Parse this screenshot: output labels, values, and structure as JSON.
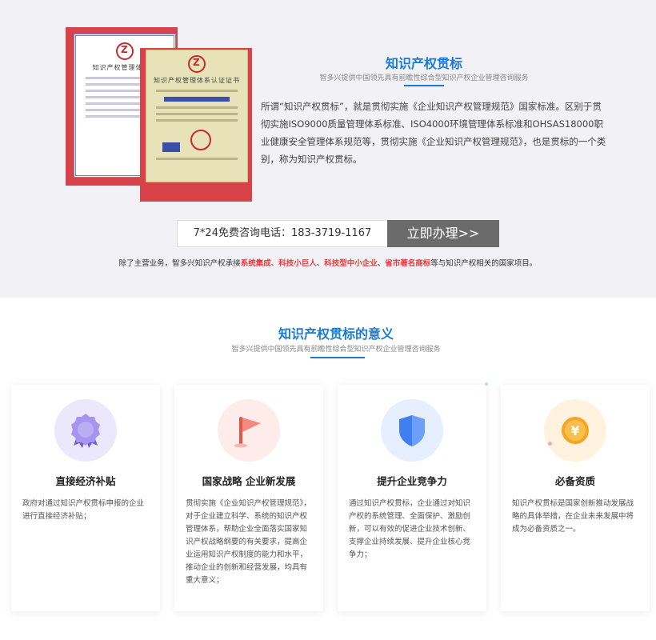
{
  "intro": {
    "title": "知识产权贯标",
    "subtitle": "智多兴提供中国领先具有前瞻性综合型知识产权企业管理咨询服务",
    "paragraph": "所谓“知识产权贯标”，就是贯彻实施《企业知识产权管理规范》国家标准。区别于贯彻实施ISO9000质量管理体系标准、ISO4000环境管理体系标准和OHSAS18000职业健康安全管理体系规范等，贯彻实施《企业知识产权管理规范》，也是贯标的一个类别，称为知识产权贯标。"
  },
  "certificates": {
    "back_title": "知识产权管理体系认",
    "front_title": "知识产权管理体系认证证书"
  },
  "consult": {
    "phone_label": "7*24免费咨询电话：183-3719-1167",
    "button_label": "立即办理>>"
  },
  "services": {
    "prefix": "除了主营业务，智多兴知识产权承接",
    "items": [
      "系统集成",
      "科技小巨人",
      "科技型中小企业",
      "省市著名商标"
    ],
    "separator": "、",
    "suffix": "等与知识产权相关的国家项目。"
  },
  "significance": {
    "title": "知识产权贯标的意义",
    "subtitle": "智多兴提供中国领先具有前瞻性综合型知识产权企业管理咨询服务",
    "cards": [
      {
        "title": "直接经济补贴",
        "desc": "政府对通过知识产权贯标申报的企业进行直接经济补贴；",
        "icon": "medal-icon",
        "color": "#8c7ae6"
      },
      {
        "title": "国家战略 企业新发展",
        "desc": "贯彻实施《企业知识产权管理规范》，对于企业建立科学、系统的知识产权管理体系，帮助企业全面落实国家知识产权战略纲要的有关要求，提高企业运用知识产权制度的能力和水平，推动企业的创新和经营发展，均具有重大意义；",
        "icon": "flag-icon",
        "color": "#f06a5e"
      },
      {
        "title": "提升企业竞争力",
        "desc": "通过知识产权贯标，企业通过对知识产权的系统管理、全面保护、激励创新，可以有效的促进企业技术创新、支撑企业持续发展、提升企业核心竞争力；",
        "icon": "shield-icon",
        "color": "#3f7ff2"
      },
      {
        "title": "必备资质",
        "desc": "知识产权贯标是国家创新推动发展战略的具体举措，在企业未来发展中将成为必备资质之一。",
        "icon": "yen-coin-icon",
        "color": "#f5a623",
        "symbol": "¥"
      }
    ]
  }
}
